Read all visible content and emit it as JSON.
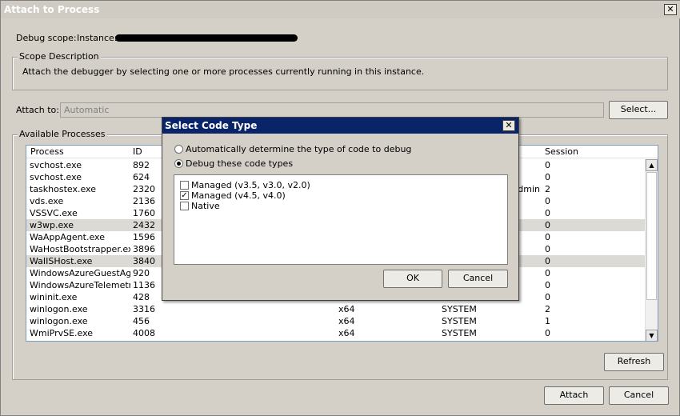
{
  "window": {
    "title": "Attach to Process"
  },
  "debug_scope": {
    "label": "Debug scope:",
    "instance_label": "Instance:"
  },
  "scope_description": {
    "legend": "Scope Description",
    "text": "Attach the debugger by selecting one or more processes currently running in this instance."
  },
  "attach_to": {
    "label": "Attach to:",
    "value": "Automatic",
    "select_button": "Select..."
  },
  "available_processes": {
    "legend": "Available Processes",
    "columns": [
      "Process",
      "ID",
      "Session"
    ],
    "rows": [
      {
        "process": "svchost.exe",
        "id": "892",
        "type": "",
        "user": "",
        "session": "0",
        "selected": false
      },
      {
        "process": "svchost.exe",
        "id": "624",
        "type": "",
        "user": "",
        "session": "0",
        "selected": false
      },
      {
        "process": "taskhostex.exe",
        "id": "2320",
        "type": "",
        "user": "dmin",
        "session": "2",
        "selected": false
      },
      {
        "process": "vds.exe",
        "id": "2136",
        "type": "",
        "user": "",
        "session": "0",
        "selected": false
      },
      {
        "process": "VSSVC.exe",
        "id": "1760",
        "type": "",
        "user": "",
        "session": "0",
        "selected": false
      },
      {
        "process": "w3wp.exe",
        "id": "2432",
        "type": "",
        "user": "",
        "session": "0",
        "selected": true
      },
      {
        "process": "WaAppAgent.exe",
        "id": "1596",
        "type": "",
        "user": "",
        "session": "0",
        "selected": false
      },
      {
        "process": "WaHostBootstrapper.exe",
        "id": "3896",
        "type": "",
        "user": "",
        "session": "0",
        "selected": false
      },
      {
        "process": "WaIISHost.exe",
        "id": "3840",
        "type": "",
        "user": "",
        "session": "0",
        "selected": true
      },
      {
        "process": "WindowsAzureGuestAg...",
        "id": "920",
        "type": "",
        "user": "",
        "session": "0",
        "selected": false
      },
      {
        "process": "WindowsAzureTelemetr...",
        "id": "1136",
        "type": "",
        "user": "",
        "session": "0",
        "selected": false
      },
      {
        "process": "wininit.exe",
        "id": "428",
        "type": "",
        "user": "",
        "session": "0",
        "selected": false
      },
      {
        "process": "winlogon.exe",
        "id": "3316",
        "type": "x64",
        "user": "SYSTEM",
        "session": "2",
        "selected": false
      },
      {
        "process": "winlogon.exe",
        "id": "456",
        "type": "x64",
        "user": "SYSTEM",
        "session": "1",
        "selected": false
      },
      {
        "process": "WmiPrvSE.exe",
        "id": "4008",
        "type": "x64",
        "user": "SYSTEM",
        "session": "0",
        "selected": false
      }
    ],
    "refresh_button": "Refresh"
  },
  "footer": {
    "attach_button": "Attach",
    "cancel_button": "Cancel"
  },
  "dialog": {
    "title": "Select Code Type",
    "auto_option": "Automatically determine the type of code to debug",
    "manual_option": "Debug these code types",
    "code_types": [
      {
        "label": "Managed (v3.5, v3.0, v2.0)",
        "checked": false
      },
      {
        "label": "Managed (v4.5, v4.0)",
        "checked": true
      },
      {
        "label": "Native",
        "checked": false
      }
    ],
    "ok_button": "OK",
    "cancel_button": "Cancel"
  },
  "icons": {
    "close": "close-icon",
    "scroll_up": "arrow-up-icon",
    "scroll_down": "arrow-down-icon",
    "check": "check-icon"
  }
}
